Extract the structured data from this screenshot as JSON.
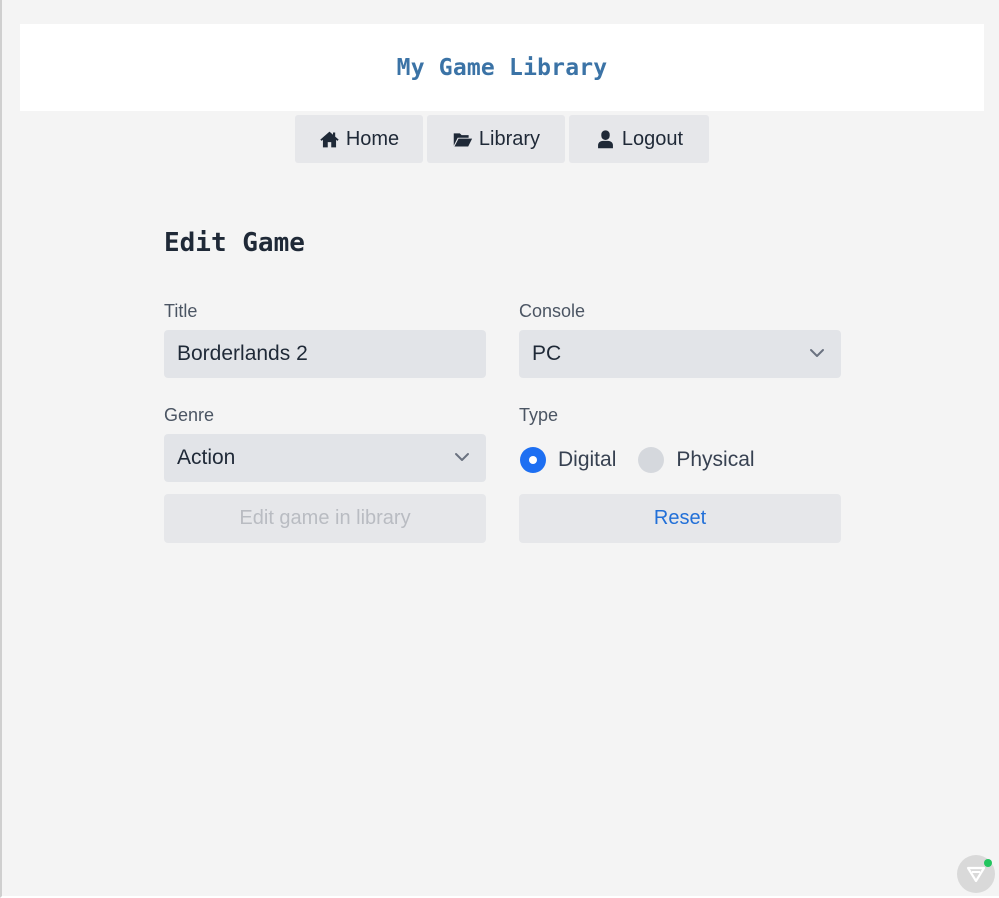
{
  "header": {
    "title": "My Game Library"
  },
  "nav": {
    "home": {
      "label": "Home",
      "icon": "home-icon"
    },
    "library": {
      "label": "Library",
      "icon": "folder-open-icon"
    },
    "logout": {
      "label": "Logout",
      "icon": "user-icon"
    }
  },
  "form": {
    "heading": "Edit Game",
    "title": {
      "label": "Title",
      "value": "Borderlands 2"
    },
    "console": {
      "label": "Console",
      "value": "PC"
    },
    "genre": {
      "label": "Genre",
      "value": "Action"
    },
    "type": {
      "label": "Type",
      "options": [
        {
          "label": "Digital",
          "checked": true
        },
        {
          "label": "Physical",
          "checked": false
        }
      ]
    },
    "submit_label": "Edit game in library",
    "reset_label": "Reset"
  },
  "colors": {
    "accent": "#1d6ff2",
    "title_blue": "#3b73a6",
    "background": "#f4f4f4",
    "field_bg": "#e2e4e8"
  }
}
